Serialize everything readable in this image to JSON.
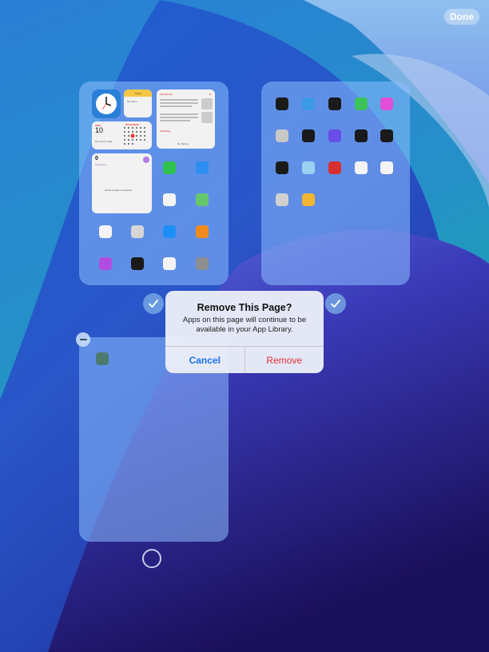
{
  "toolbar": {
    "done_label": "Done"
  },
  "alert": {
    "title": "Remove This Page?",
    "message": "Apps on this page will continue to be available in your App Library.",
    "cancel_label": "Cancel",
    "remove_label": "Remove"
  },
  "widgets": {
    "news_title": "Top Stories",
    "news_trending": "Trending",
    "news_footer": "No Stories",
    "calendar_month": "DECEMBER",
    "calendar_day": "10",
    "calendar_note": "No events today",
    "reminders_count": "0",
    "reminders_label": "Reminders",
    "reminders_status": "All Reminders Completed",
    "notes_label": "Notes",
    "notes_sub": "No Notes"
  },
  "page1_apps": [
    {
      "icon": "facetime-icon",
      "color": "#2fc24f"
    },
    {
      "icon": "files-icon",
      "color": "#2b8ef0"
    },
    {
      "icon": "reminders-icon",
      "color": "#f4f4f4"
    },
    {
      "icon": "maps-icon",
      "color": "#66c76a"
    },
    {
      "icon": "home-icon",
      "color": "#f4f4f4"
    },
    {
      "icon": "camera-icon",
      "color": "#d6d6d6"
    },
    {
      "icon": "app-store-icon",
      "color": "#1d8ef5"
    },
    {
      "icon": "books-icon",
      "color": "#f28a1e"
    },
    {
      "icon": "podcasts-icon",
      "color": "#b04de0"
    },
    {
      "icon": "apple-tv-icon",
      "color": "#1a1a1a"
    },
    {
      "icon": "news-icon",
      "color": "#f4f4f4"
    },
    {
      "icon": "settings-icon",
      "color": "#8e8e93"
    }
  ],
  "page2_apps": [
    {
      "icon": "clock-icon",
      "color": "#1a1a1a"
    },
    {
      "icon": "weather-icon",
      "color": "#3a9ae8"
    },
    {
      "icon": "stocks-icon",
      "color": "#1a1a1a"
    },
    {
      "icon": "find-my-icon",
      "color": "#3cc35a"
    },
    {
      "icon": "itunes-store-icon",
      "color": "#e04fd6"
    },
    {
      "icon": "contacts-icon",
      "color": "#c8c8c8"
    },
    {
      "icon": "game-center-icon",
      "color": "#1a1a1a"
    },
    {
      "icon": "shortcuts-icon",
      "color": "#6a4de8"
    },
    {
      "icon": "voice-memos-icon",
      "color": "#1a1a1a"
    },
    {
      "icon": "measure-icon",
      "color": "#1a1a1a"
    },
    {
      "icon": "magnifier-icon",
      "color": "#1a1a1a"
    },
    {
      "icon": "utilities-icon",
      "color": "#9ad0f0"
    },
    {
      "icon": "photo-booth-icon",
      "color": "#d83030"
    },
    {
      "icon": "freeform-icon",
      "color": "#f4f4f4"
    },
    {
      "icon": "health-icon",
      "color": "#f4f4f4"
    },
    {
      "icon": "calculator-icon",
      "color": "#d0d0d0"
    },
    {
      "icon": "tips-icon",
      "color": "#f2b530"
    }
  ],
  "page3_apps": [
    {
      "icon": "app-icon",
      "color": "#4c7a70"
    }
  ],
  "colors": {
    "accent_blue": "#1a73e8",
    "destructive_red": "#e5303a"
  }
}
